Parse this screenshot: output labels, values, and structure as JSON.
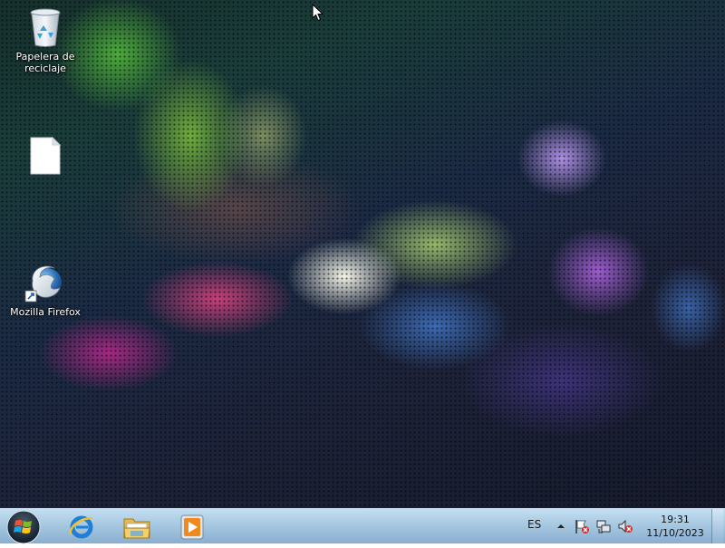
{
  "desktop": {
    "icons": [
      {
        "id": "recycle-bin",
        "label": "Papelera de reciclaje",
        "icon": "recycle-bin-icon"
      },
      {
        "id": "blank-file",
        "label": "",
        "icon": "blank-file-icon"
      },
      {
        "id": "firefox",
        "label": "Mozilla Firefox",
        "icon": "firefox-icon"
      }
    ]
  },
  "taskbar": {
    "start_icon": "windows-start-orb-icon",
    "pinned": [
      {
        "id": "internet-explorer",
        "icon": "internet-explorer-icon"
      },
      {
        "id": "windows-explorer",
        "icon": "folder-libraries-icon"
      },
      {
        "id": "media-player",
        "icon": "media-player-icon"
      }
    ],
    "tray": {
      "language": "ES",
      "icons": [
        "show-hidden-icons-arrow",
        "action-center-flag-icon",
        "network-icon",
        "volume-muted-icon"
      ],
      "time": "19:31",
      "date": "11/10/2023"
    }
  }
}
